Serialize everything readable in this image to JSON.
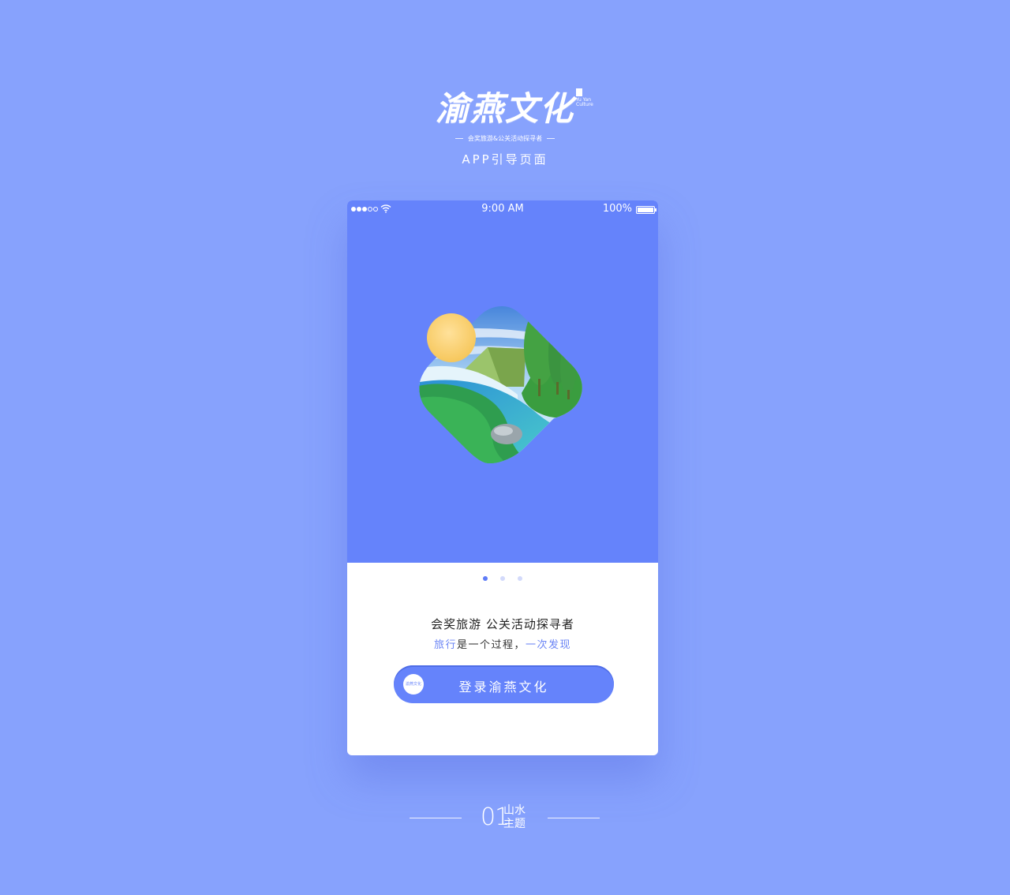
{
  "brand": {
    "title": "渝燕文化",
    "english": "Yu Yan Culture",
    "slogan": "会奖旅游&公关活动探寻者",
    "subtitle": "APP引导页面"
  },
  "statusbar": {
    "time": "9:00 AM",
    "battery": "100%"
  },
  "onboarding": {
    "page_count": 3,
    "active_page": 1,
    "tagline": "会奖旅游 公关活动探寻者",
    "subline_part1": "旅行",
    "subline_part2": "是一个过程，",
    "subline_part3": "一次发现",
    "login_label": "登录渝燕文化",
    "login_avatar_text": "渝燕文化"
  },
  "footer": {
    "number": "01",
    "line1": "山水",
    "line2": "主题"
  },
  "colors": {
    "background": "#87a2fd",
    "hero": "#6583fb",
    "accent": "#6b85f5",
    "dot_active": "#5f7cf7",
    "dot_inactive": "#d3dafb"
  }
}
